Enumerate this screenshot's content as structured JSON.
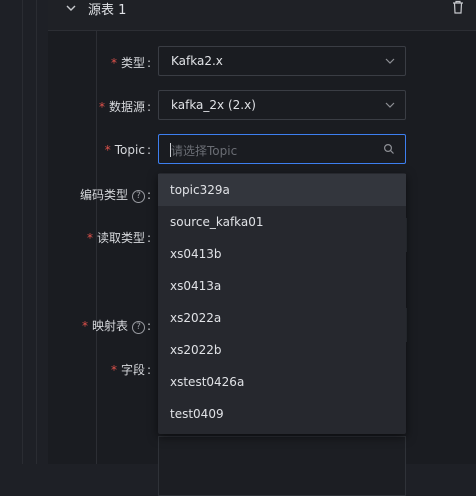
{
  "panel": {
    "title": "源表 1"
  },
  "form": {
    "type": {
      "required": "*",
      "label": "类型",
      "value": "Kafka2.x"
    },
    "datasource": {
      "required": "*",
      "label": "数据源",
      "value": "kafka_2x (2.x)"
    },
    "topic": {
      "required": "*",
      "label": "Topic",
      "placeholder": "请选择Topic"
    },
    "encoding": {
      "label": "编码类型",
      "help": "?"
    },
    "read_type": {
      "required": "*",
      "label": "读取类型"
    },
    "mapping_table": {
      "required": "*",
      "label": "映射表",
      "help": "?"
    },
    "fields": {
      "required": "*",
      "label": "字段"
    },
    "colon": ":"
  },
  "topic_dropdown": {
    "options": [
      "topic329a",
      "source_kafka01",
      "xs0413b",
      "xs0413a",
      "xs2022a",
      "xs2022b",
      "xstest0426a",
      "test0409"
    ],
    "active_index": 0
  },
  "icons": {
    "collapse": "chevron-down-icon",
    "delete": "trash-icon",
    "select_arrow": "chevron-down-icon",
    "search": "search-icon"
  },
  "colors": {
    "accent": "#3d7ff0",
    "required": "#e0524b",
    "background": "#1a1c21"
  }
}
